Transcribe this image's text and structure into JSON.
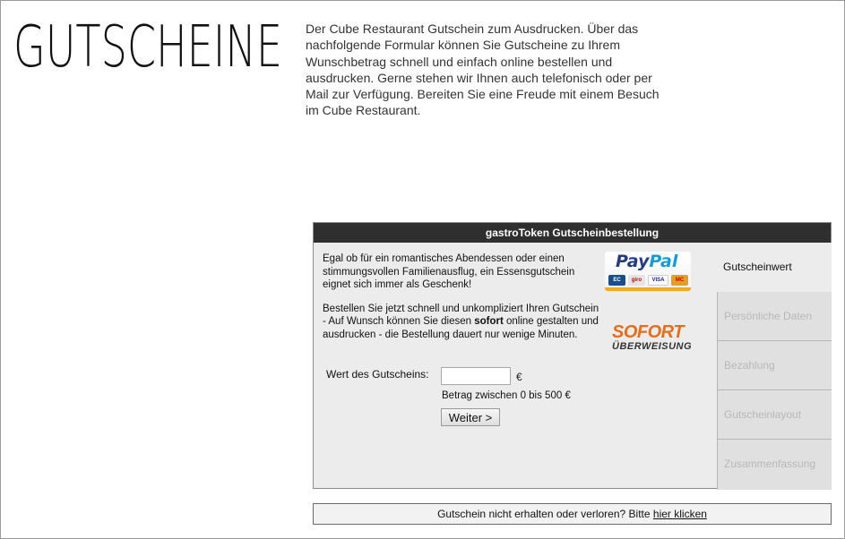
{
  "page": {
    "title": "GUTSCHEINE",
    "intro": "Der Cube Restaurant Gutschein zum Ausdrucken. Über das nachfolgende Formular können Sie Gutscheine zu Ihrem Wunschbetrag schnell und einfach online bestellen und ausdrucken. Gerne stehen wir Ihnen auch telefonisch oder per Mail zur Verfügung. Bereiten Sie eine Freude mit einem Besuch im Cube Restaurant."
  },
  "widget": {
    "header": "gastroToken Gutscheinbestellung",
    "paragraph1": "Egal ob für ein romantisches Abendessen oder einen stimmungsvollen Familienausflug, ein Essensgutschein eignet sich immer als Geschenk!",
    "paragraph2_pre": "Bestellen Sie jetzt schnell und unkompliziert Ihren Gutschein - Auf Wunsch können Sie diesen ",
    "paragraph2_bold": "sofort",
    "paragraph2_post": " online gestalten und ausdrucken - die Bestellung dauert nur wenige Minuten.",
    "logos": {
      "paypal_a": "Pay",
      "paypal_b": "Pal",
      "cards": [
        "EC",
        "giro",
        "VISA",
        "MC"
      ],
      "sofort_top": "SOFORT",
      "sofort_bottom": "ÜBERWEISUNG"
    },
    "form": {
      "label": "Wert des Gutscheins:",
      "value": "",
      "currency": "€",
      "hint": "Betrag zwischen 0 bis 500 €",
      "next_label": "Weiter >"
    },
    "steps": [
      {
        "label": "Gutscheinwert",
        "active": true
      },
      {
        "label": "Persönliche Daten",
        "active": false
      },
      {
        "label": "Bezahlung",
        "active": false
      },
      {
        "label": "Gutscheinlayout",
        "active": false
      },
      {
        "label": "Zusammenfassung",
        "active": false
      }
    ]
  },
  "footer": {
    "text": "Gutschein nicht erhalten oder verloren? Bitte ",
    "link": "hier klicken"
  },
  "colors": {
    "header_bg": "#2f2f2f",
    "panel_bg": "#ececec",
    "sofort_orange": "#e36f1e",
    "paypal_dark": "#253b80",
    "paypal_light": "#179bd7"
  }
}
